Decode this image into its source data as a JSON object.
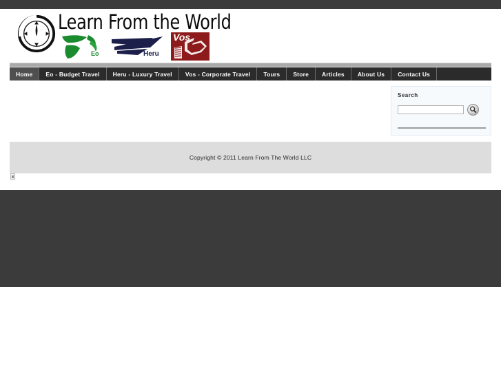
{
  "site": {
    "brand_title": "Learn From the World",
    "sub_brands": [
      {
        "name": "Eo",
        "label": "Eo",
        "color": "#1b8b2f"
      },
      {
        "name": "Heru",
        "label": "Heru",
        "color": "#1c1f4a"
      },
      {
        "name": "Vos",
        "label": "Vos",
        "color": "#8e1b1b"
      }
    ]
  },
  "nav": {
    "items": [
      {
        "label": "Home",
        "active": true
      },
      {
        "label": "Eo - Budget Travel",
        "active": false
      },
      {
        "label": "Heru - Luxury Travel",
        "active": false
      },
      {
        "label": "Vos - Corporate Travel",
        "active": false
      },
      {
        "label": "Tours",
        "active": false
      },
      {
        "label": "Store",
        "active": false
      },
      {
        "label": "Articles",
        "active": false
      },
      {
        "label": "About Us",
        "active": false
      },
      {
        "label": "Contact Us",
        "active": false
      }
    ]
  },
  "sidebar": {
    "search": {
      "title": "Search",
      "value": "",
      "placeholder": "",
      "button_icon": "search-icon"
    }
  },
  "main": {
    "body_text": ""
  },
  "footer": {
    "copyright": "Copyright © 2011 Learn From The World LLC"
  },
  "colors": {
    "top_strip": "#3b3b3b",
    "nav_bg": "#2b2b2b",
    "nav_active": "#4f4f4f",
    "footer_bg": "#dddddd",
    "separator": "#a9a9a9",
    "sidebar_bg": "#f7fafd"
  }
}
